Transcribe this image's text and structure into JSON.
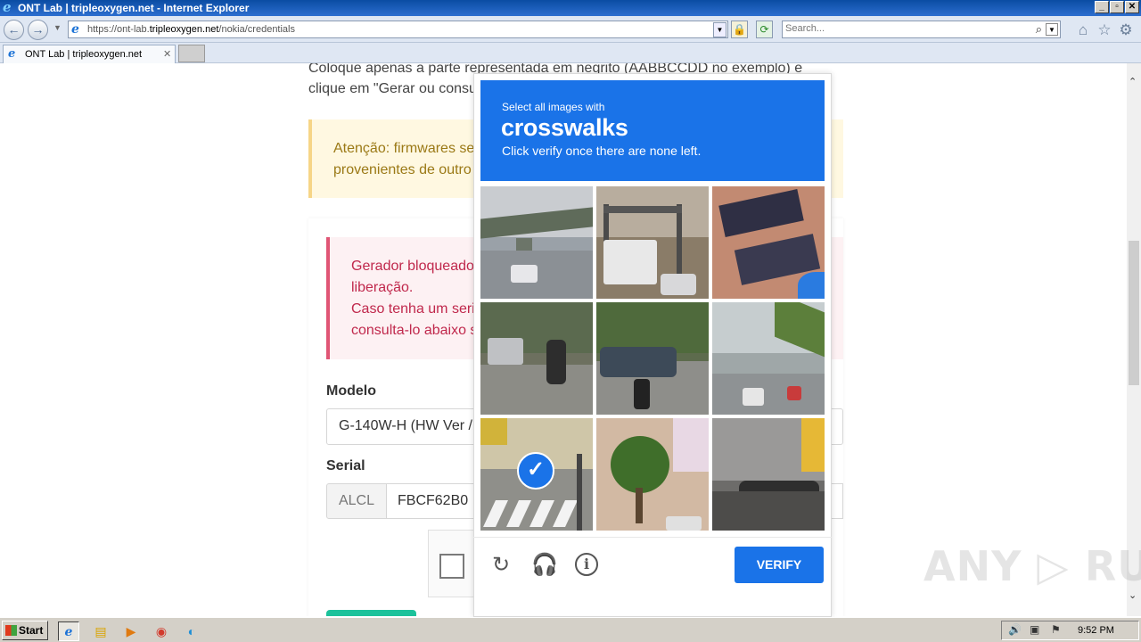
{
  "window": {
    "title": "ONT Lab | tripleoxygen.net - Internet Explorer",
    "controls": [
      "_",
      "▫",
      "✕"
    ]
  },
  "browser": {
    "url_prefix": "https://ont-lab.",
    "url_domain": "tripleoxygen.net",
    "url_path": "/nokia/credentials",
    "search_placeholder": "Search...",
    "tab_label": "ONT Lab | tripleoxygen.net",
    "tab_close": "✕"
  },
  "page": {
    "para_line1": "Coloque apenas a parte representada em negrito (AABBCCDD no exemplo) e",
    "para_line2": "clique em \"Gerar ou consu",
    "warning_line1": "Atenção: firmwares ser",
    "warning_line2": "provenientes de outro",
    "danger_line1": "Gerador bloqueado",
    "danger_line2": "liberação.",
    "danger_line3": "Caso tenha um seria",
    "danger_line4": "consulta-lo abaixo s",
    "modelo_label": "Modelo",
    "modelo_value": "G-140W-H (HW Ver /",
    "serial_label": "Serial",
    "serial_prefix": "ALCL",
    "serial_value": "FBCF62B0"
  },
  "captcha": {
    "instruction_small": "Select all images with",
    "target_word": "crosswalks",
    "instruction_sub": "Click verify once there are none left.",
    "verify_label": "VERIFY",
    "selected_tile": 7,
    "tiles": [
      {
        "name": "tile-highway-overpass",
        "selected": false
      },
      {
        "name": "tile-gantry-traffic",
        "selected": false
      },
      {
        "name": "tile-building-balcony",
        "selected": false
      },
      {
        "name": "tile-motorcycle-street",
        "selected": false
      },
      {
        "name": "tile-car-motorcycle-road",
        "selected": false
      },
      {
        "name": "tile-elevated-road-traffic",
        "selected": false
      },
      {
        "name": "tile-crosswalk-pedestrians",
        "selected": true
      },
      {
        "name": "tile-tree-building",
        "selected": false
      },
      {
        "name": "tile-bus-shelter",
        "selected": false
      }
    ]
  },
  "watermark": "ANY ▷ RUN",
  "taskbar": {
    "start_label": "Start",
    "clock": "9:52 PM"
  },
  "colors": {
    "captcha_blue": "#1a73e8",
    "warning_bg": "#fff8e1",
    "danger_text": "#c0284c"
  }
}
